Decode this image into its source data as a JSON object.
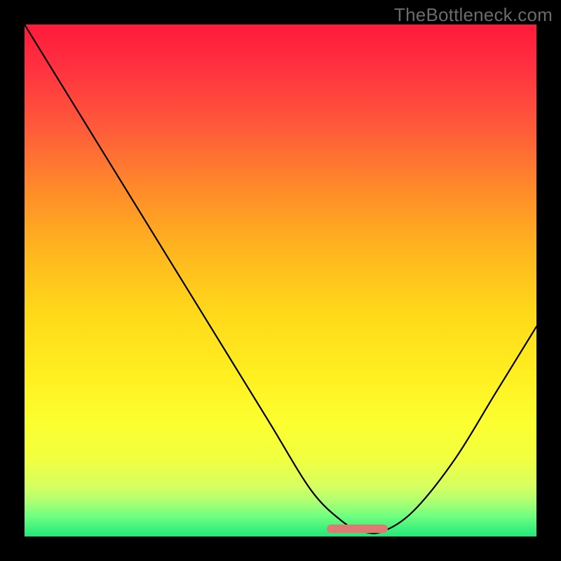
{
  "watermark": "TheBottleneck.com",
  "chart_data": {
    "type": "line",
    "title": "",
    "xlabel": "",
    "ylabel": "",
    "xlim": [
      0,
      1
    ],
    "ylim": [
      0,
      1
    ],
    "series": [
      {
        "name": "curve",
        "x": [
          0.0,
          0.08,
          0.16,
          0.24,
          0.32,
          0.4,
          0.48,
          0.56,
          0.62,
          0.66,
          0.7,
          0.76,
          0.84,
          0.92,
          1.0
        ],
        "y": [
          1.0,
          0.87,
          0.74,
          0.61,
          0.48,
          0.35,
          0.22,
          0.09,
          0.03,
          0.01,
          0.01,
          0.05,
          0.15,
          0.28,
          0.41
        ]
      }
    ],
    "annotations": [
      {
        "name": "valley-marker",
        "x_range": [
          0.59,
          0.71
        ],
        "y": 0.015,
        "color": "#dd7a72"
      }
    ],
    "background_gradient": [
      "#ff1a3a",
      "#ffd81a",
      "#20e87a"
    ]
  }
}
